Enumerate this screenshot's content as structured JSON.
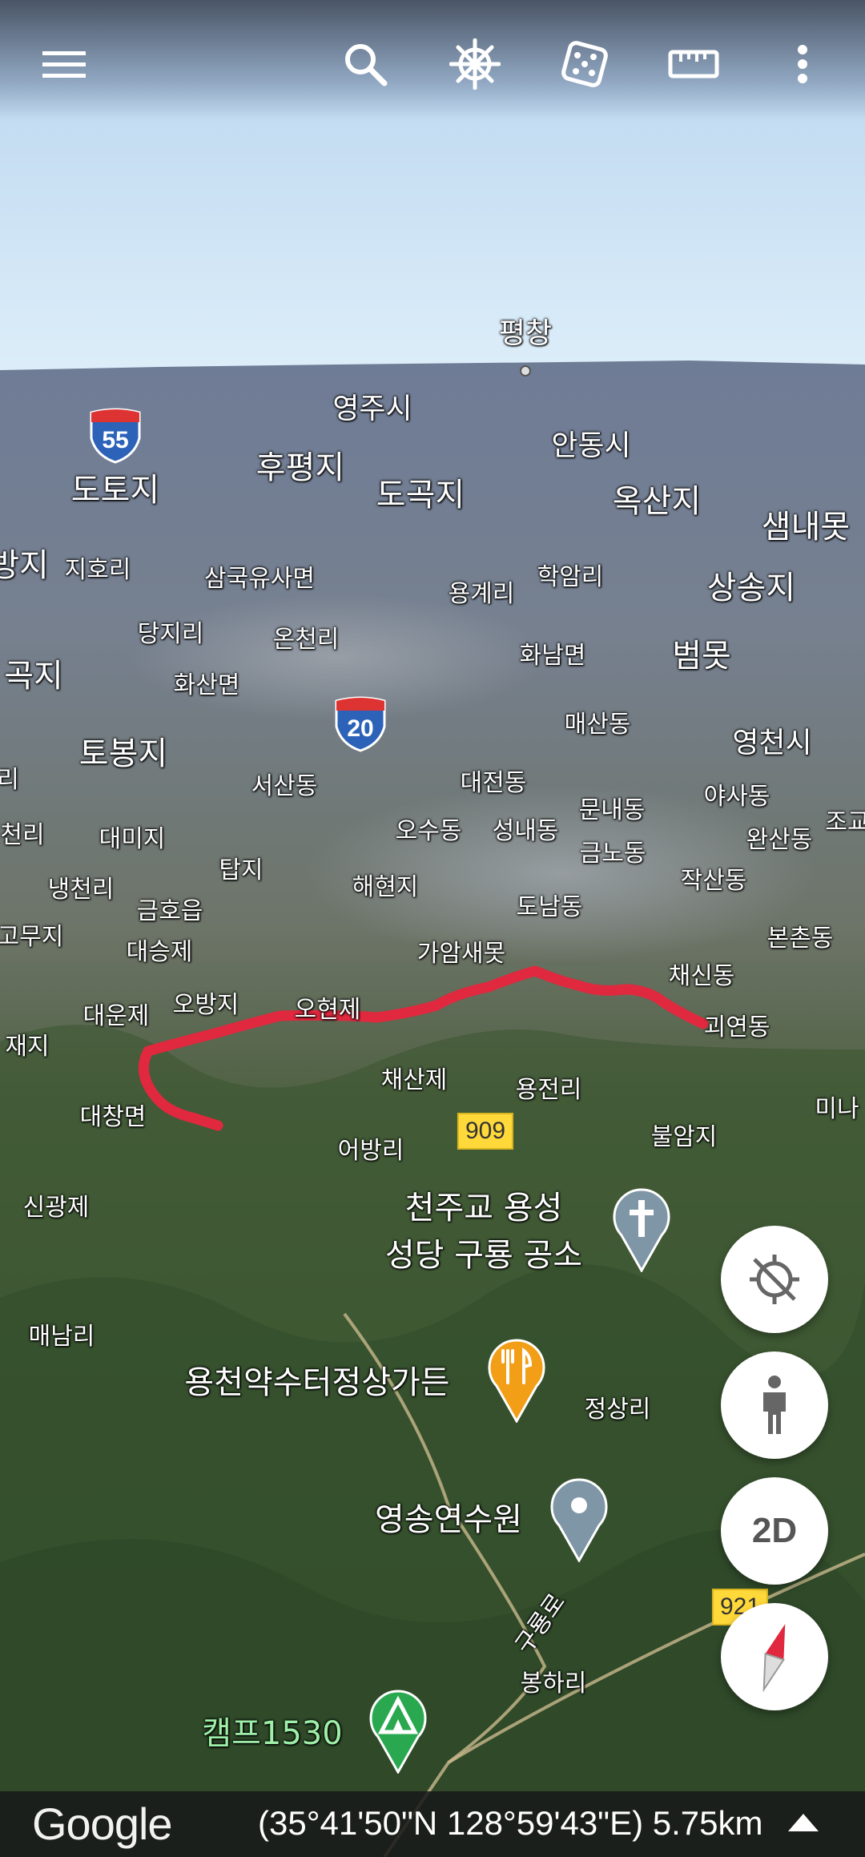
{
  "top_bar": {
    "icons": [
      "menu-icon",
      "search-icon",
      "voyager-helm-icon",
      "dice-icon",
      "ruler-icon",
      "more-vert-icon"
    ]
  },
  "place_labels": {
    "pyeongchang": "평창",
    "yeongju": "영주시",
    "andong": "안동시",
    "dotoji": "도토지",
    "hupyeongji": "후평지",
    "dogokji": "도곡지",
    "oksanji": "옥산지",
    "saemnaemot": "샘내못",
    "bangji": "방지",
    "jihori": "지호리",
    "samguk": "삼국유사면",
    "yonggyeri": "용계리",
    "hakamri": "학암리",
    "sangsongji": "상송지",
    "dangjiri": "당지리",
    "oncheonri": "온천리",
    "hwanammyeon": "화남면",
    "beommot": "범못",
    "gokji": "곡지",
    "hwasanmyeon": "화산면",
    "maesandong": "매산동",
    "yeongcheonsi": "영천시",
    "tobongji": "토봉지",
    "ri_left": "리",
    "seosandong": "서산동",
    "daejeondong": "대전동",
    "yasadong": "야사동",
    "jo": "조교",
    "cheonri": "천리",
    "daemiji": "대미지",
    "osudong": "오수동",
    "seongnaedong": "성내동",
    "munnaedong": "문내동",
    "wansandong": "완산동",
    "geumnodong": "금노동",
    "tapji": "탑지",
    "naengcheonri": "냉천리",
    "haehyeonji": "해현지",
    "jaksandong": "작산동",
    "geumhoeup": "금호읍",
    "donamdong": "도남동",
    "bonchondong": "본촌동",
    "gomuji": "고무지",
    "daeseungje": "대승제",
    "gaamsaemot": "가암새못",
    "chaesindong": "채신동",
    "obangji": "오방지",
    "ohyeonje": "오현제",
    "daeunje": "대운제",
    "goeyeondong": "괴연동",
    "jaeji": "재지",
    "chaesanje": "채산제",
    "yongjeonri": "용전리",
    "mina": "미나",
    "daechangmyeon": "대창면",
    "bulamji": "불암지",
    "eobangri": "어방리",
    "singwangje": "신광제",
    "maenamri": "매남리",
    "jeongsangri": "정상리",
    "gureongno": "구룡로",
    "bonghari": "봉하리"
  },
  "highways": [
    {
      "number": "55",
      "color": "#2c62b8"
    },
    {
      "number": "20",
      "color": "#2c62b8"
    }
  ],
  "route_badges": [
    "909",
    "921"
  ],
  "pois": [
    {
      "name_line1": "천주교 용성",
      "name_line2": "성당 구룡 공소",
      "icon": "cross-pin-icon",
      "color": "#7f96a6"
    },
    {
      "name": "용천약수터정상가든",
      "icon": "restaurant-pin-icon",
      "color": "#f29e16"
    },
    {
      "name": "영송연수원",
      "icon": "place-pin-icon",
      "color": "#7f96a6"
    },
    {
      "name": "캠프1530",
      "icon": "campground-pin-icon",
      "color": "#2aa84f"
    }
  ],
  "track_color": "#e0283e",
  "fabs": {
    "location_icon": "location-disabled-icon",
    "streetview_icon": "pegman-icon",
    "mode_label": "2D",
    "compass_icon": "compass-icon"
  },
  "bottom_bar": {
    "logo": "Google",
    "coordinates": "(35°41'50\"N 128°59'43\"E) 5.75km",
    "expand_icon": "expand-up-icon"
  }
}
